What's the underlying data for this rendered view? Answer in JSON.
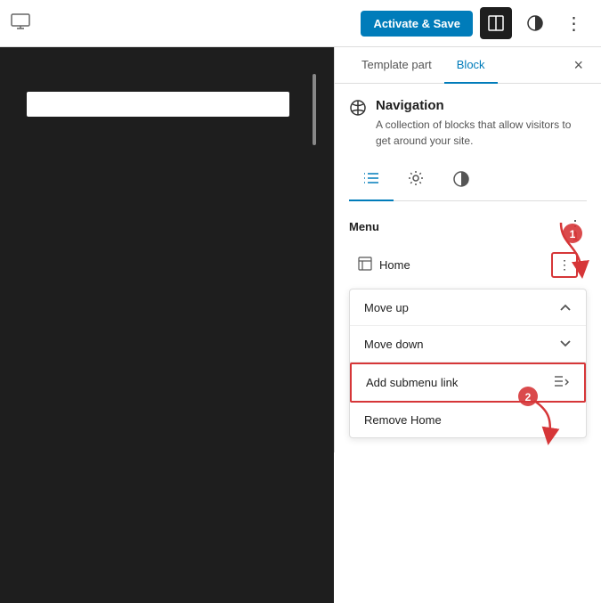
{
  "topbar": {
    "activate_label": "Activate & Save",
    "monitor_icon": "□",
    "layout_icon": "⬛",
    "contrast_icon": "◑",
    "more_icon": "⋮"
  },
  "sidebar": {
    "tab_template": "Template part",
    "tab_block": "Block",
    "close_icon": "×",
    "block": {
      "icon": "⊙",
      "title": "Navigation",
      "description": "A collection of blocks that allow visitors to get around your site."
    },
    "subtabs": [
      {
        "icon": "≡",
        "active": true
      },
      {
        "icon": "⚙",
        "active": false
      },
      {
        "icon": "◑",
        "active": false
      }
    ],
    "section_title": "Menu",
    "more_icon": "⋮",
    "menu_items": [
      {
        "icon": "▤",
        "label": "Home"
      }
    ],
    "dropdown": [
      {
        "label": "Move up",
        "icon": "∧"
      },
      {
        "label": "Move down",
        "icon": "∨"
      },
      {
        "label": "Add submenu link",
        "icon": "⊏≡",
        "highlighted": true
      },
      {
        "label": "Remove Home",
        "icon": ""
      }
    ],
    "step1_label": "1",
    "step2_label": "2"
  }
}
